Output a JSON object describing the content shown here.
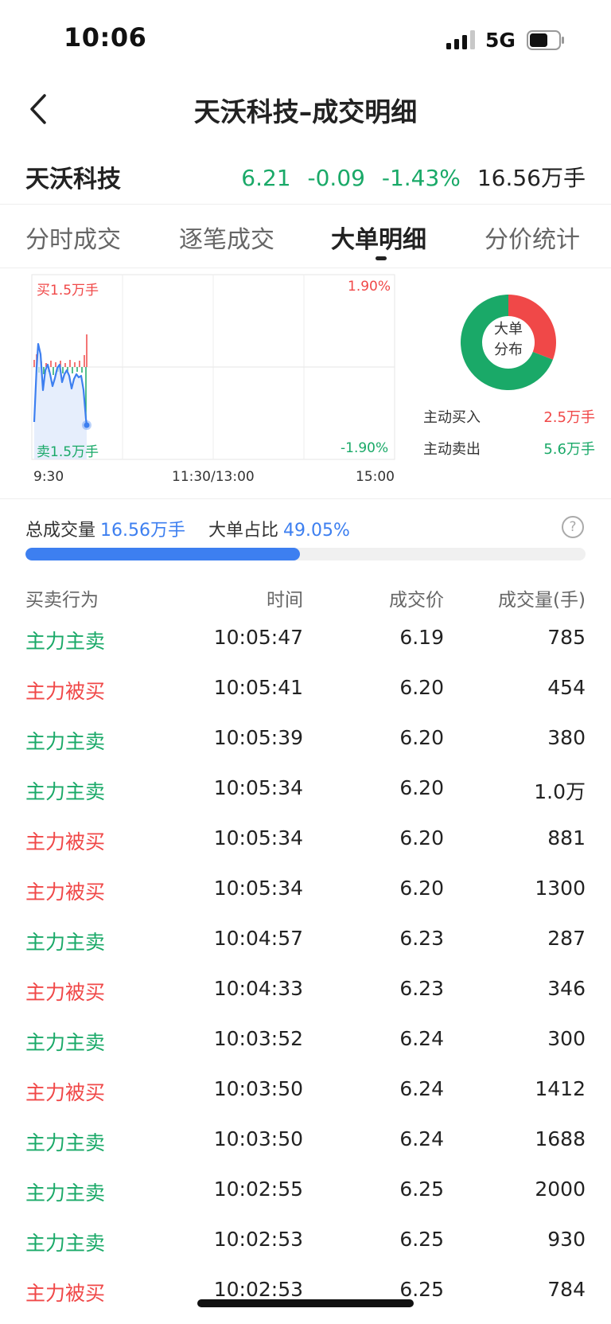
{
  "status_bar": {
    "time": "10:06",
    "network": "5G"
  },
  "nav": {
    "title": "天沃科技–成交明细"
  },
  "quote": {
    "name": "天沃科技",
    "price": "6.21",
    "change": "-0.09",
    "change_pct": "-1.43%",
    "volume": "16.56万手"
  },
  "tabs": [
    {
      "label": "分时成交"
    },
    {
      "label": "逐笔成交"
    },
    {
      "label": "大单明细",
      "active": true
    },
    {
      "label": "分价统计"
    }
  ],
  "chart": {
    "buy_label": "买1.5万手",
    "sell_label": "卖1.5万手",
    "pct_top": "1.90%",
    "pct_bottom": "-1.90%",
    "x_start": "9:30",
    "x_mid": "11:30/13:00",
    "x_end": "15:00"
  },
  "distribution": {
    "center_line1": "大单",
    "center_line2": "分布",
    "buy_label": "主动买入",
    "buy_value": "2.5万手",
    "sell_label": "主动卖出",
    "sell_value": "5.6万手",
    "colors": {
      "buy": "#f04848",
      "sell": "#1aa968"
    }
  },
  "summary": {
    "total_label": "总成交量",
    "total_value": "16.56万手",
    "ratio_label": "大单占比",
    "ratio_value": "49.05%",
    "ratio_fraction": 0.4905
  },
  "table": {
    "headers": [
      "买卖行为",
      "时间",
      "成交价",
      "成交量(手)"
    ],
    "rows": [
      {
        "action": "主力主卖",
        "side": "sell",
        "time": "10:05:47",
        "price": "6.19",
        "volume": "785"
      },
      {
        "action": "主力被买",
        "side": "buy",
        "time": "10:05:41",
        "price": "6.20",
        "volume": "454"
      },
      {
        "action": "主力主卖",
        "side": "sell",
        "time": "10:05:39",
        "price": "6.20",
        "volume": "380"
      },
      {
        "action": "主力主卖",
        "side": "sell",
        "time": "10:05:34",
        "price": "6.20",
        "volume": "1.0万"
      },
      {
        "action": "主力被买",
        "side": "buy",
        "time": "10:05:34",
        "price": "6.20",
        "volume": "881"
      },
      {
        "action": "主力被买",
        "side": "buy",
        "time": "10:05:34",
        "price": "6.20",
        "volume": "1300"
      },
      {
        "action": "主力主卖",
        "side": "sell",
        "time": "10:04:57",
        "price": "6.23",
        "volume": "287"
      },
      {
        "action": "主力被买",
        "side": "buy",
        "time": "10:04:33",
        "price": "6.23",
        "volume": "346"
      },
      {
        "action": "主力主卖",
        "side": "sell",
        "time": "10:03:52",
        "price": "6.24",
        "volume": "300"
      },
      {
        "action": "主力被买",
        "side": "buy",
        "time": "10:03:50",
        "price": "6.24",
        "volume": "1412"
      },
      {
        "action": "主力主卖",
        "side": "sell",
        "time": "10:03:50",
        "price": "6.24",
        "volume": "1688"
      },
      {
        "action": "主力主卖",
        "side": "sell",
        "time": "10:02:55",
        "price": "6.25",
        "volume": "2000"
      },
      {
        "action": "主力主卖",
        "side": "sell",
        "time": "10:02:53",
        "price": "6.25",
        "volume": "930"
      },
      {
        "action": "主力被买",
        "side": "buy",
        "time": "10:02:53",
        "price": "6.25",
        "volume": "784"
      }
    ]
  }
}
